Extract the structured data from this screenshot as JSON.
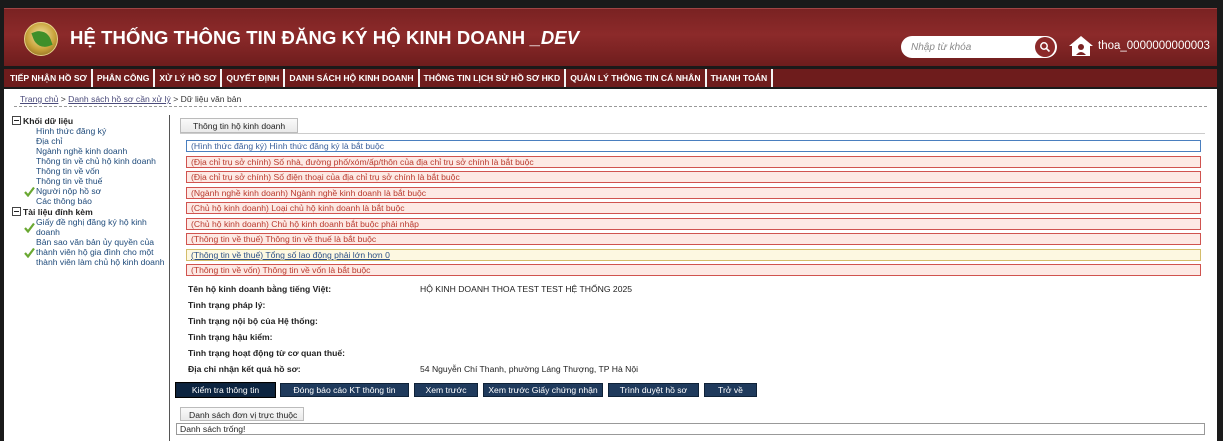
{
  "header": {
    "title_main": "HỆ THỐNG THÔNG TIN ĐĂNG KÝ HỘ KINH DOANH ",
    "title_dev": "_DEV",
    "search_placeholder": "Nhập từ khóa",
    "user_name": "thoa_0000000000003"
  },
  "menu": [
    "TIẾP NHẬN HỒ SƠ",
    "PHÂN CÔNG",
    "XỬ LÝ HỒ SƠ",
    "QUYẾT ĐỊNH",
    "DANH SÁCH HỘ KINH DOANH",
    "THÔNG TIN LỊCH SỬ HỒ SƠ HKD",
    "QUẢN LÝ THÔNG TIN CÁ NHÂN",
    "THANH TOÁN"
  ],
  "breadcrumb": {
    "home": "Trang chủ",
    "sep1": " > ",
    "list": "Danh sách hồ sơ cần xử lý",
    "sep2": " > ",
    "current": "Dữ liệu văn bản"
  },
  "sidebar": {
    "group1": "Khối dữ liệu",
    "items1": [
      "Hình thức đăng ký",
      "Địa chỉ",
      "Ngành nghề kinh doanh",
      "Thông tin về chủ hộ kinh doanh",
      "Thông tin về vốn",
      "Thông tin về thuế",
      "Người nộp hồ sơ",
      "Các thông báo"
    ],
    "group2": "Tài liệu đính kèm",
    "items2": [
      "Giấy đề nghị đăng ký hộ kinh doanh",
      "Bản sao văn bản ủy quyền của thành viên hộ gia đình cho một thành viên làm chủ hộ kinh doanh"
    ]
  },
  "main": {
    "tab_label": "Thông tin hộ kinh doanh",
    "messages": [
      "(Hình thức đăng ký) Hình thức đăng ký là bắt buộc",
      "(Địa chỉ trụ sở chính) Số nhà, đường phố/xóm/ấp/thôn của địa chỉ trụ sở chính là bắt buộc",
      "(Địa chỉ trụ sở chính) Số điện thoại của địa chỉ trụ sở chính là bắt buộc",
      "(Ngành nghề kinh doanh) Ngành nghề kinh doanh là bắt buộc",
      "(Chủ hộ kinh doanh) Loại chủ hộ kinh doanh là bắt buộc",
      "(Chủ hộ kinh doanh) Chủ hộ kinh doanh bắt buộc phải nhập",
      "(Thông tin về thuế) Thông tin về thuế là bắt buộc",
      "(Thông tin về thuế) Tổng số lao động phải lớn hơn 0",
      "(Thông tin về vốn) Thông tin về vốn là bắt buộc"
    ],
    "fields": [
      {
        "label": "Tên hộ kinh doanh bằng tiếng Việt:",
        "value": "HỘ KINH DOANH THOA TEST TEST HỆ THỐNG 2025"
      },
      {
        "label": "Tình trạng pháp lý:",
        "value": ""
      },
      {
        "label": "Tình trạng nội bộ của Hệ thống:",
        "value": ""
      },
      {
        "label": "Tình trạng hậu kiểm:",
        "value": ""
      },
      {
        "label": "Tình trạng hoạt động từ cơ quan thuế:",
        "value": ""
      },
      {
        "label": "Địa chỉ nhận kết quả hồ sơ:",
        "value": "54 Nguyễn Chí Thanh, phường Láng Thượng, TP Hà Nội"
      }
    ],
    "buttons": [
      "Kiểm tra thông tin",
      "Đóng báo cáo KT thông tin",
      "Xem trước",
      "Xem trước Giấy chứng nhận",
      "Trình duyệt hồ sơ",
      "Trở về"
    ],
    "list_tab_label": "Danh sách đơn vị trực thuộc",
    "list_empty": "Danh sách trống!"
  },
  "colors": {
    "header_bg": "#7a2222",
    "menu_bg": "#6e1c1c",
    "button_bg": "#1f3a5c",
    "error_border": "#d0534f",
    "error_bg": "#fde9e4"
  }
}
